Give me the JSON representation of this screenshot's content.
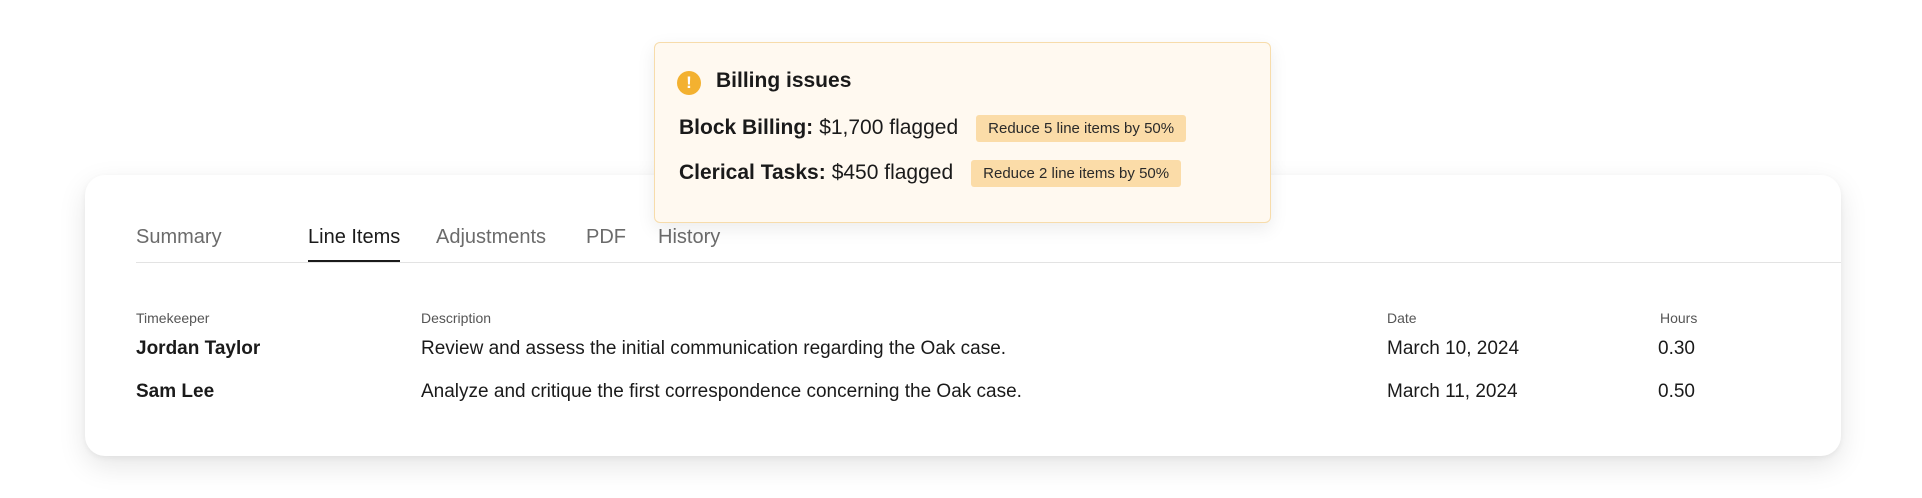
{
  "tabs": [
    {
      "label": "Summary",
      "active": false
    },
    {
      "label": "Line Items",
      "active": true
    },
    {
      "label": "Adjustments",
      "active": false
    },
    {
      "label": "PDF",
      "active": false
    },
    {
      "label": "History",
      "active": false
    }
  ],
  "table": {
    "columns": [
      "Timekeeper",
      "Description",
      "Date",
      "Hours"
    ],
    "rows": [
      {
        "timekeeper": "Jordan Taylor",
        "description": "Review and assess the initial communication regarding the Oak case.",
        "date": "March 10, 2024",
        "hours": "0.30"
      },
      {
        "timekeeper": "Sam Lee",
        "description": "Analyze and critique the first correspondence concerning the Oak case.",
        "date": "March 11, 2024",
        "hours": "0.50"
      }
    ]
  },
  "billing_issues": {
    "icon": "warning-icon",
    "icon_glyph": "!",
    "title": "Billing issues",
    "accent_color": "#f3b130",
    "badge_color": "#fbdca8",
    "items": [
      {
        "name": "Block Billing:",
        "amount": "$1,700 flagged",
        "action": "Reduce 5 line items by 50%"
      },
      {
        "name": "Clerical Tasks:",
        "amount": "$450 flagged",
        "action": "Reduce 2 line items by 50%"
      }
    ]
  }
}
